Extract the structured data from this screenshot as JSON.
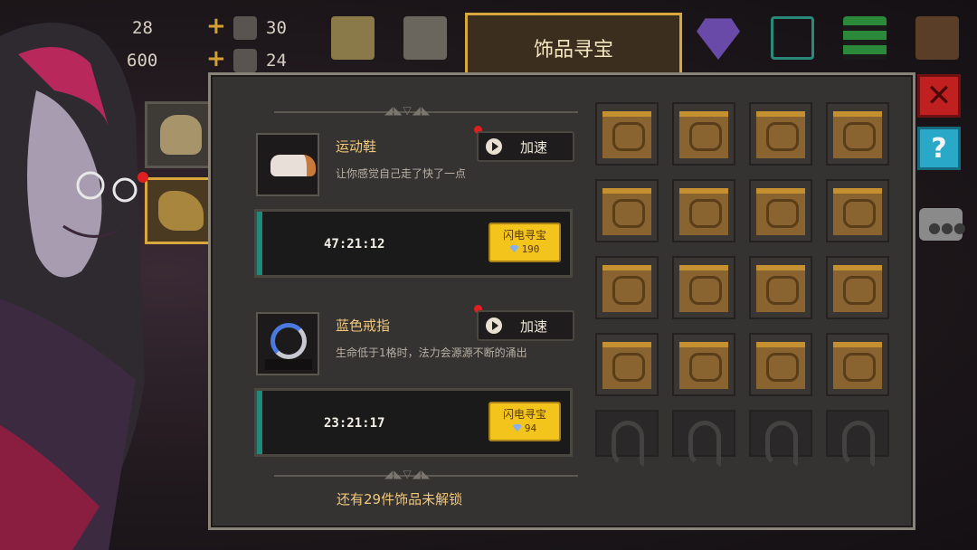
{
  "top_bar": {
    "gems_value": "28",
    "coins_value": "600",
    "material1_value": "30",
    "material2_value": "24",
    "icons": [
      "character-icon",
      "camera-icon",
      "gem-shop-icon",
      "cart-icon",
      "menu-icon",
      "exit-icon"
    ]
  },
  "panel": {
    "title": "饰品寻宝",
    "items": [
      {
        "name": "运动鞋",
        "desc": "让你感觉自己走了快了一点",
        "speed_label": "加速",
        "timer": "47:21:12",
        "flash_label": "闪电寻宝",
        "cost": "190",
        "icon": "sneaker-icon"
      },
      {
        "name": "蓝色戒指",
        "desc": "生命低于1格时，法力会源源不断的涌出",
        "speed_label": "加速",
        "timer": "23:21:17",
        "flash_label": "闪电寻宝",
        "cost": "94",
        "icon": "ring-icon"
      }
    ],
    "footer": "还有29件饰品未解锁",
    "unlocked_slots": 16,
    "locked_slots": 4
  },
  "colors": {
    "accent_gold": "#d8a83c",
    "flash_yellow": "#f2c41c",
    "progress_teal": "#1f8a7a",
    "close_red": "#c02020",
    "help_cyan": "#2aa8c8"
  }
}
